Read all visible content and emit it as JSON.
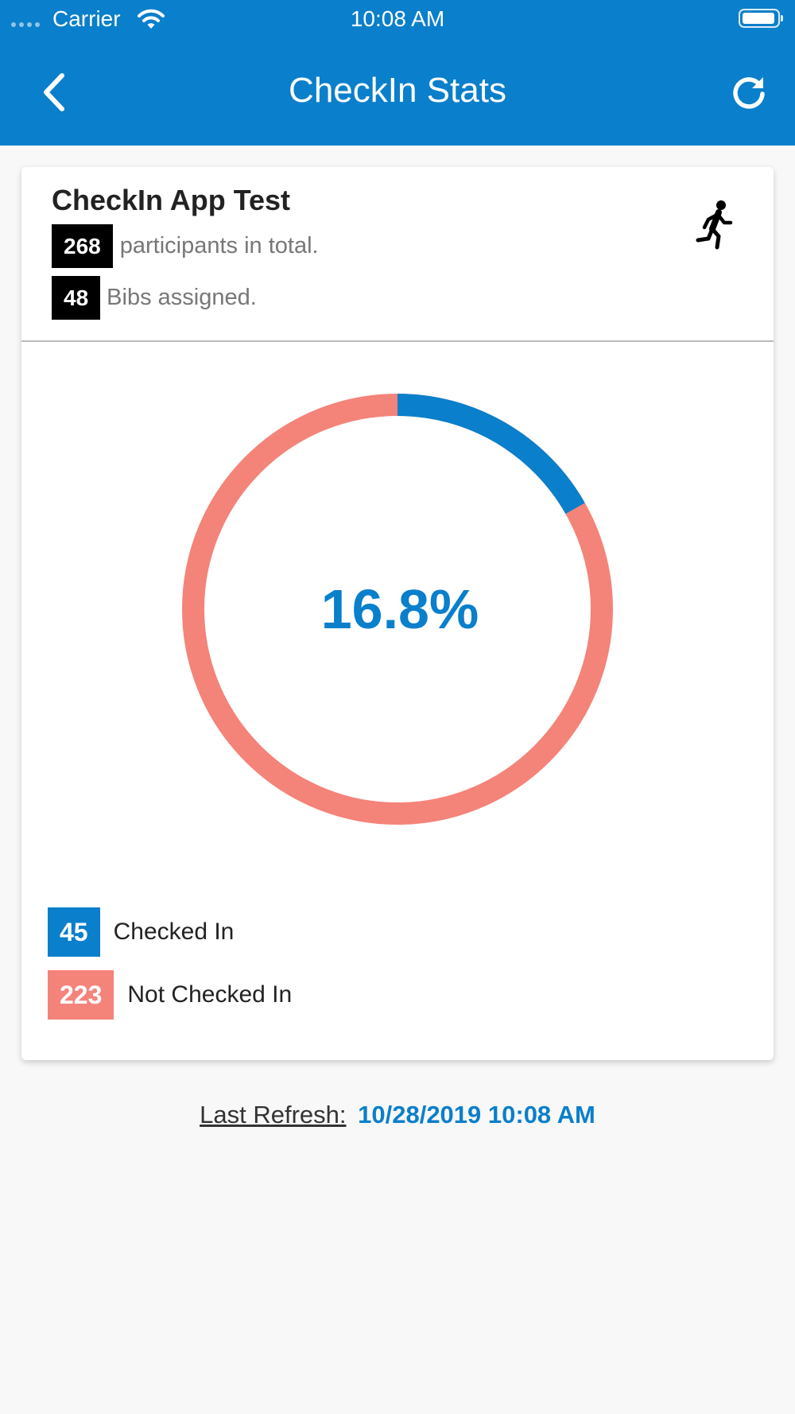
{
  "status_bar": {
    "carrier": "Carrier",
    "time": "10:08 AM",
    "battery_level": 0.95
  },
  "nav": {
    "title": "CheckIn Stats",
    "back_icon": "chevron-left-icon",
    "refresh_icon": "refresh-icon"
  },
  "event": {
    "name": "CheckIn App Test",
    "icon": "runner-icon",
    "participants_total": "268",
    "participants_label": "participants in total.",
    "bibs_assigned": "48",
    "bibs_label": "Bibs assigned."
  },
  "stats": {
    "percent_label": "16.8%",
    "checked_in": 45,
    "not_checked_in": 223,
    "checked_in_label": "Checked In",
    "not_checked_in_label": "Not Checked In"
  },
  "colors": {
    "primary": "#0a7fcb",
    "checked_in": "#0a7fcb",
    "not_checked_in": "#f4837a",
    "badge": "#000000"
  },
  "footer": {
    "last_refresh_label": "Last Refresh:",
    "last_refresh_value": "10/28/2019 10:08 AM"
  }
}
